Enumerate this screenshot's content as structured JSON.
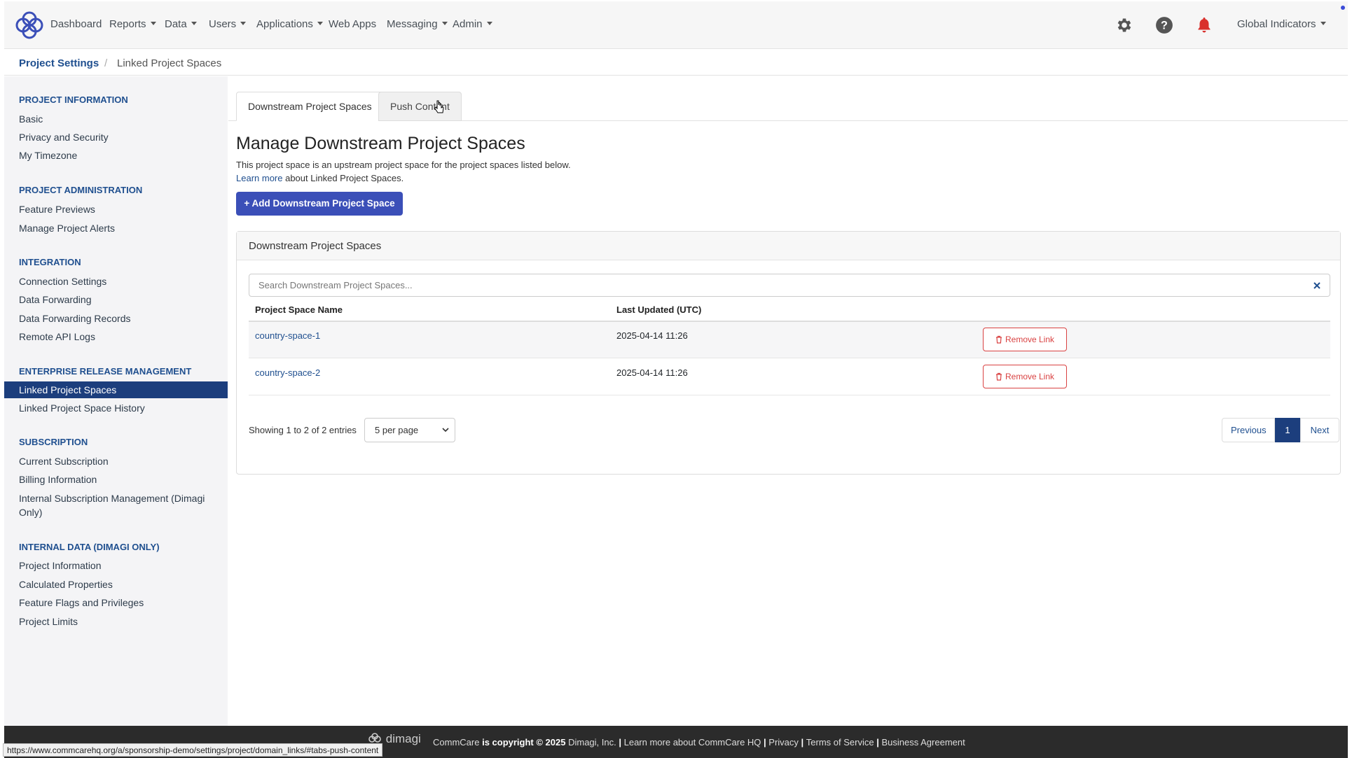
{
  "nav": {
    "items": [
      {
        "label": "Dashboard",
        "dropdown": false
      },
      {
        "label": "Reports",
        "dropdown": true
      },
      {
        "label": "Data",
        "dropdown": true
      },
      {
        "label": "Users",
        "dropdown": true
      },
      {
        "label": "Applications",
        "dropdown": true
      },
      {
        "label": "Web Apps",
        "dropdown": false
      },
      {
        "label": "Messaging",
        "dropdown": true
      },
      {
        "label": "Admin",
        "dropdown": true
      }
    ],
    "icons": [
      "gear-icon",
      "help-icon",
      "bell-icon"
    ],
    "account_label": "Global Indicators",
    "bell_color": "#d9302c",
    "brand_color": "#3b4fb8"
  },
  "breadcrumb": {
    "parent": "Project Settings",
    "separator": "/",
    "current": "Linked Project Spaces"
  },
  "sidebar": {
    "sections": [
      {
        "heading": "Project Information",
        "items": [
          "Basic",
          "Privacy and Security",
          "My Timezone"
        ]
      },
      {
        "heading": "Project Administration",
        "items": [
          "Feature Previews",
          "Manage Project Alerts"
        ]
      },
      {
        "heading": "Integration",
        "items": [
          "Connection Settings",
          "Data Forwarding",
          "Data Forwarding Records",
          "Remote API Logs"
        ]
      },
      {
        "heading": "Enterprise Release Management",
        "items": [
          "Linked Project Spaces",
          "Linked Project Space History"
        ]
      },
      {
        "heading": "Subscription",
        "items": [
          "Current Subscription",
          "Billing Information",
          "Internal Subscription Management (Dimagi",
          "Only)"
        ]
      },
      {
        "heading": "Internal Data (Dimagi Only)",
        "items": [
          "Project Information",
          "Calculated Properties",
          "Feature Flags and Privileges",
          "Project Limits"
        ]
      }
    ],
    "active_item": "Linked Project Spaces"
  },
  "tabs": [
    {
      "label": "Downstream Project Spaces",
      "active": true
    },
    {
      "label": "Push Content",
      "active": false
    }
  ],
  "main": {
    "title": "Manage Downstream Project Spaces",
    "description": "This project space is an upstream project space for the project spaces listed below.",
    "learn_more_link": "Learn more",
    "learn_more_rest": " about Linked Project Spaces.",
    "add_button": "+ Add Downstream Project Space"
  },
  "panel": {
    "title": "Downstream Project Spaces",
    "search_placeholder": "Search Downstream Project Spaces...",
    "search_value": "",
    "clear_icon": "close-icon",
    "columns": [
      "Project Space Name",
      "Last Updated (UTC)"
    ],
    "rows": [
      {
        "name": "country-space-1",
        "updated": "2025-04-14 11:26",
        "action": "Remove Link"
      },
      {
        "name": "country-space-2",
        "updated": "2025-04-14 11:26",
        "action": "Remove Link"
      }
    ],
    "showing": "Showing 1 to 2 of 2 entries",
    "per_page": "5 per page",
    "pagination": {
      "previous": "Previous",
      "current": "1",
      "next": "Next"
    }
  },
  "footer": {
    "logo_text": "dimagi",
    "copyright_pre": "CommCare",
    "copyright_mid": " is copyright © 2025 ",
    "copyright_org": "Dimagi, Inc.",
    "links": [
      "Learn more about CommCare HQ",
      "Privacy",
      "Terms of Service",
      "Business Agreement"
    ],
    "separator": "|"
  },
  "status_bar_url": "https://www.commcarehq.org/a/sponsorship-demo/settings/project/domain_links/#tabs-push-content"
}
